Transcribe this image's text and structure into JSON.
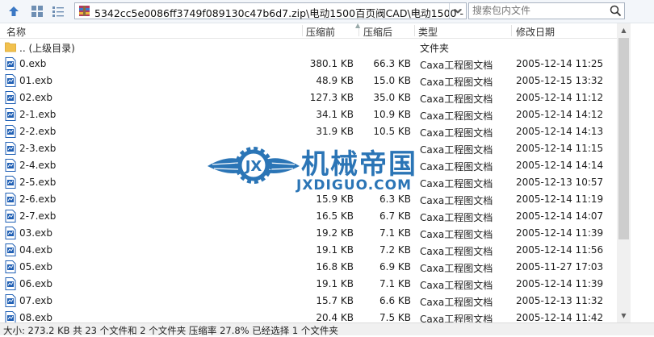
{
  "toolbar": {
    "address": "5342cc5e0086ff3749f089130c47b6d7.zip\\电动1500百页阀CAD\\电动1500",
    "address_truncation": "-",
    "search_placeholder": "搜索包内文件"
  },
  "columns": {
    "name": "名称",
    "compressed": "压缩前",
    "packed": "压缩后",
    "type": "类型",
    "modified": "修改日期"
  },
  "rows": [
    {
      "name": ".. (上级目录)",
      "compressed": "",
      "packed": "",
      "type": "文件夹",
      "modified": "",
      "icon": "folder-icon"
    },
    {
      "name": "0.exb",
      "compressed": "380.1 KB",
      "packed": "66.3 KB",
      "type": "Caxa工程图文档",
      "modified": "2005-12-14 11:25",
      "icon": "file-icon"
    },
    {
      "name": "01.exb",
      "compressed": "48.9 KB",
      "packed": "15.0 KB",
      "type": "Caxa工程图文档",
      "modified": "2005-12-15 13:32",
      "icon": "file-icon"
    },
    {
      "name": "02.exb",
      "compressed": "127.3 KB",
      "packed": "35.0 KB",
      "type": "Caxa工程图文档",
      "modified": "2005-12-14 11:12",
      "icon": "file-icon"
    },
    {
      "name": "2-1.exb",
      "compressed": "34.1 KB",
      "packed": "10.9 KB",
      "type": "Caxa工程图文档",
      "modified": "2005-12-14 14:12",
      "icon": "file-icon"
    },
    {
      "name": "2-2.exb",
      "compressed": "31.9 KB",
      "packed": "10.5 KB",
      "type": "Caxa工程图文档",
      "modified": "2005-12-14 14:13",
      "icon": "file-icon"
    },
    {
      "name": "2-3.exb",
      "compressed": "",
      "packed": "",
      "type": "Caxa工程图文档",
      "modified": "2005-12-14 11:15",
      "icon": "file-icon"
    },
    {
      "name": "2-4.exb",
      "compressed": "",
      "packed": "",
      "type": "Caxa工程图文档",
      "modified": "2005-12-14 14:14",
      "icon": "file-icon"
    },
    {
      "name": "2-5.exb",
      "compressed": "",
      "packed": "",
      "type": "Caxa工程图文档",
      "modified": "2005-12-13 10:57",
      "icon": "file-icon"
    },
    {
      "name": "2-6.exb",
      "compressed": "15.9 KB",
      "packed": "6.3 KB",
      "type": "Caxa工程图文档",
      "modified": "2005-12-14 11:19",
      "icon": "file-icon"
    },
    {
      "name": "2-7.exb",
      "compressed": "16.5 KB",
      "packed": "6.7 KB",
      "type": "Caxa工程图文档",
      "modified": "2005-12-14 14:07",
      "icon": "file-icon"
    },
    {
      "name": "03.exb",
      "compressed": "19.2 KB",
      "packed": "7.1 KB",
      "type": "Caxa工程图文档",
      "modified": "2005-12-14 11:39",
      "icon": "file-icon"
    },
    {
      "name": "04.exb",
      "compressed": "19.1 KB",
      "packed": "7.2 KB",
      "type": "Caxa工程图文档",
      "modified": "2005-12-14 11:56",
      "icon": "file-icon"
    },
    {
      "name": "05.exb",
      "compressed": "16.8 KB",
      "packed": "6.9 KB",
      "type": "Caxa工程图文档",
      "modified": "2005-11-27 17:03",
      "icon": "file-icon"
    },
    {
      "name": "06.exb",
      "compressed": "19.1 KB",
      "packed": "7.1 KB",
      "type": "Caxa工程图文档",
      "modified": "2005-12-14 11:39",
      "icon": "file-icon"
    },
    {
      "name": "07.exb",
      "compressed": "15.7 KB",
      "packed": "6.6 KB",
      "type": "Caxa工程图文档",
      "modified": "2005-12-13 11:32",
      "icon": "file-icon"
    },
    {
      "name": "08.exb",
      "compressed": "20.4 KB",
      "packed": "7.5 KB",
      "type": "Caxa工程图文档",
      "modified": "2005-12-14 11:42",
      "icon": "file-icon"
    }
  ],
  "status": "大小: 273.2 KB 共 23 个文件和 2 个文件夹 压缩率 27.8% 已经选择 1 个文件夹",
  "watermark": {
    "title": "机械帝国",
    "subtitle": "JXDIGUO.COM"
  },
  "colors": {
    "accent": "#2b75b6",
    "folder": "#f2c14e",
    "file_icon": "#1f5fb4"
  }
}
